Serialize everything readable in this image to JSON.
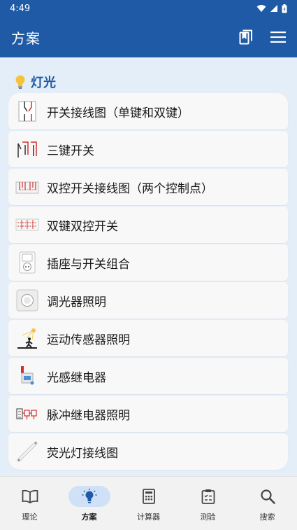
{
  "status_bar": {
    "time": "4:49"
  },
  "app_bar": {
    "title": "方案"
  },
  "colors": {
    "primary": "#1f5aa6",
    "content_bg": "#e4eef9",
    "active_nav_bg": "#cfe0f7"
  },
  "section": {
    "icon": "lightbulb-icon",
    "title": "灯光"
  },
  "items": [
    {
      "label": "开关接线图（单键和双键）",
      "icon": "switch-wiring-icon"
    },
    {
      "label": "三键开关",
      "icon": "triple-switch-icon"
    },
    {
      "label": "双控开关接线图（两个控制点）",
      "icon": "two-way-switch-icon"
    },
    {
      "label": "双键双控开关",
      "icon": "double-two-way-switch-icon"
    },
    {
      "label": "插座与开关组合",
      "icon": "socket-switch-icon"
    },
    {
      "label": "调光器照明",
      "icon": "dimmer-icon"
    },
    {
      "label": "运动传感器照明",
      "icon": "motion-sensor-icon"
    },
    {
      "label": "光感继电器",
      "icon": "photo-relay-icon"
    },
    {
      "label": "脉冲继电器照明",
      "icon": "impulse-relay-icon"
    },
    {
      "label": "荧光灯接线图",
      "icon": "fluorescent-lamp-icon"
    }
  ],
  "bottom_nav": [
    {
      "label": "理论",
      "icon": "book-icon",
      "active": false
    },
    {
      "label": "方案",
      "icon": "lightbulb-icon",
      "active": true
    },
    {
      "label": "计算器",
      "icon": "calculator-icon",
      "active": false
    },
    {
      "label": "测验",
      "icon": "clipboard-icon",
      "active": false
    },
    {
      "label": "搜索",
      "icon": "search-icon",
      "active": false
    }
  ]
}
